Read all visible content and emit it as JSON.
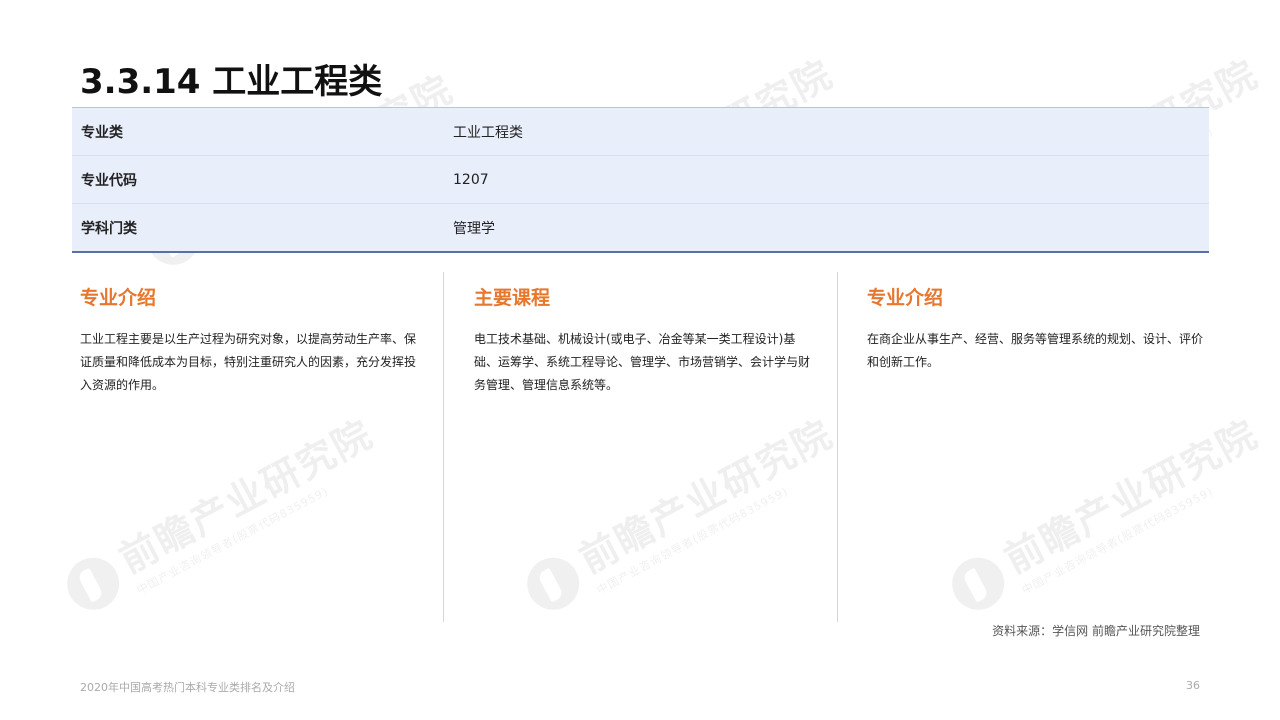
{
  "title": "3.3.14 工业工程类",
  "info_table": [
    {
      "key": "专业类",
      "value": "工业工程类"
    },
    {
      "key": "专业代码",
      "value": "1207"
    },
    {
      "key": "学科门类",
      "value": "管理学"
    }
  ],
  "columns": [
    {
      "heading": "专业介绍",
      "body": "工业工程主要是以生产过程为研究对象，以提高劳动生产率、保证质量和降低成本为目标，特别注重研究人的因素，充分发挥投入资源的作用。"
    },
    {
      "heading": "主要课程",
      "body": "电工技术基础、机械设计(或电子、冶金等某一类工程设计)基础、运筹学、系统工程导论、管理学、市场营销学、会计学与财务管理、管理信息系统等。"
    },
    {
      "heading": "专业介绍",
      "body": "在商企业从事生产、经营、服务等管理系统的规划、设计、评价和创新工作。"
    }
  ],
  "source": "资料来源：学信网 前瞻产业研究院整理",
  "footer": {
    "report_title": "2020年中国高考热门本科专业类排名及介绍",
    "page_number": "36"
  },
  "watermark": {
    "brand": "前瞻产业研究院",
    "tagline": "中国产业咨询领导者(股票代码835959)"
  },
  "colors": {
    "accent": "#e8772e",
    "table_bg": "#e9eefb",
    "table_border": "#5a6fa8"
  }
}
